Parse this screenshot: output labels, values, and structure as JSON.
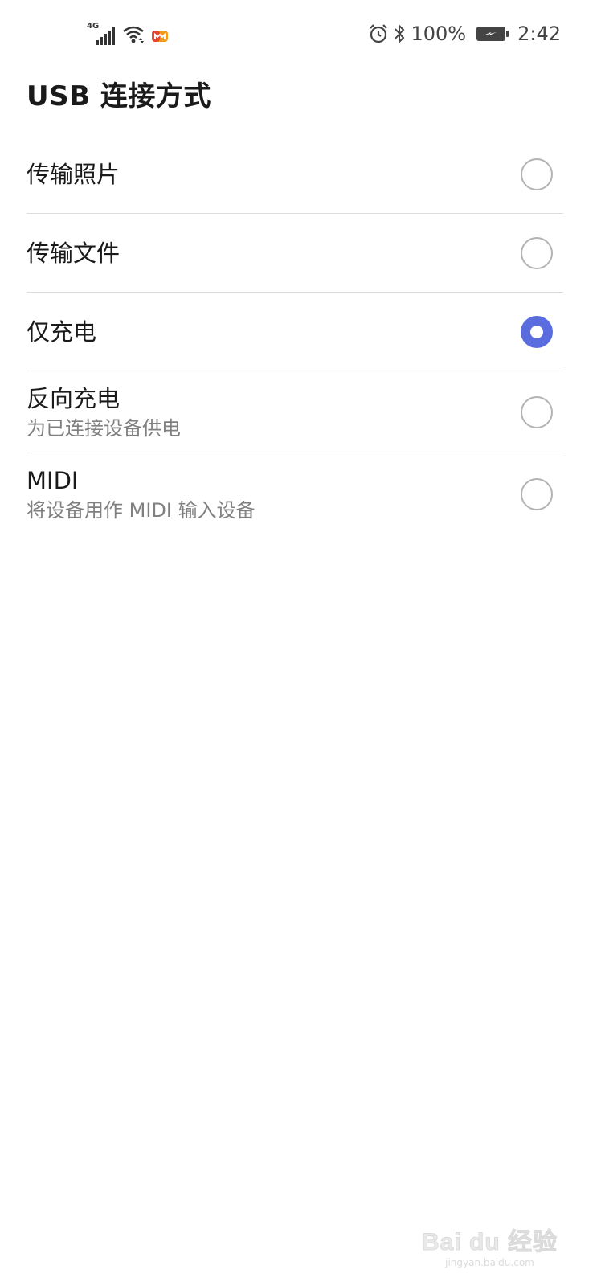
{
  "status_bar": {
    "network_label": "4G",
    "battery_percent": "100%",
    "time": "2:42",
    "icons": [
      "signal-icon",
      "wifi-icon",
      "app-notification-icon",
      "alarm-icon",
      "bluetooth-icon",
      "battery-charging-icon"
    ]
  },
  "page": {
    "title": "USB 连接方式"
  },
  "options": [
    {
      "title": "传输照片",
      "subtitle": "",
      "selected": false
    },
    {
      "title": "传输文件",
      "subtitle": "",
      "selected": false
    },
    {
      "title": "仅充电",
      "subtitle": "",
      "selected": true
    },
    {
      "title": "反向充电",
      "subtitle": "为已连接设备供电",
      "selected": false
    },
    {
      "title": "MIDI",
      "subtitle": "将设备用作 MIDI 输入设备",
      "selected": false
    }
  ],
  "colors": {
    "accent": "#5b6dde",
    "divider": "#dcdcdc",
    "secondary_text": "#808080"
  },
  "watermark": {
    "logo": "Bai du 经验",
    "url": "jingyan.baidu.com"
  }
}
